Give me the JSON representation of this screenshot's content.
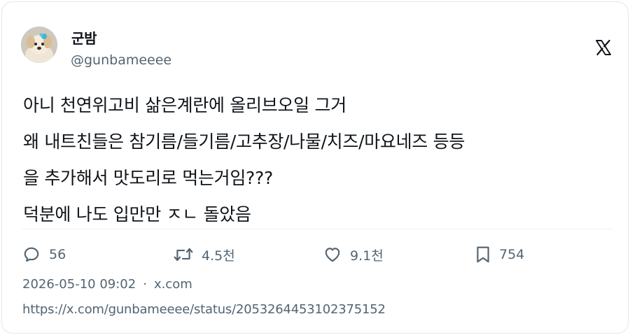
{
  "author": {
    "display_name": "군밤",
    "handle": "@gunbameeee",
    "avatar_icon": "puppy-avatar"
  },
  "brand": {
    "logo_icon": "x-logo-icon"
  },
  "tweet": {
    "lines": [
      "아니 천연위고비 삶은계란에 올리브오일 그거",
      "왜 내트친들은 참기름/들기름/고추장/나물/치즈/마요네즈 등등",
      "을 추가해서 맛도리로 먹는거임???",
      "덕분에 나도 입만만 ㅈㄴ 돌았음"
    ]
  },
  "actions": {
    "replies": {
      "icon": "reply-icon",
      "count": "56"
    },
    "retweets": {
      "icon": "retweet-icon",
      "count": "4.5천"
    },
    "likes": {
      "icon": "heart-icon",
      "count": "9.1천"
    },
    "bookmarks": {
      "icon": "bookmark-icon",
      "count": "754"
    }
  },
  "meta": {
    "timestamp": "2026-05-10 09:02",
    "separator": "·",
    "source": "x.com"
  },
  "url": "https://x.com/gunbameeee/status/2053264453102375152",
  "colors": {
    "text_primary": "#0f1419",
    "text_secondary": "#536471",
    "border": "#e3e6e9",
    "divider": "#eff3f4"
  }
}
